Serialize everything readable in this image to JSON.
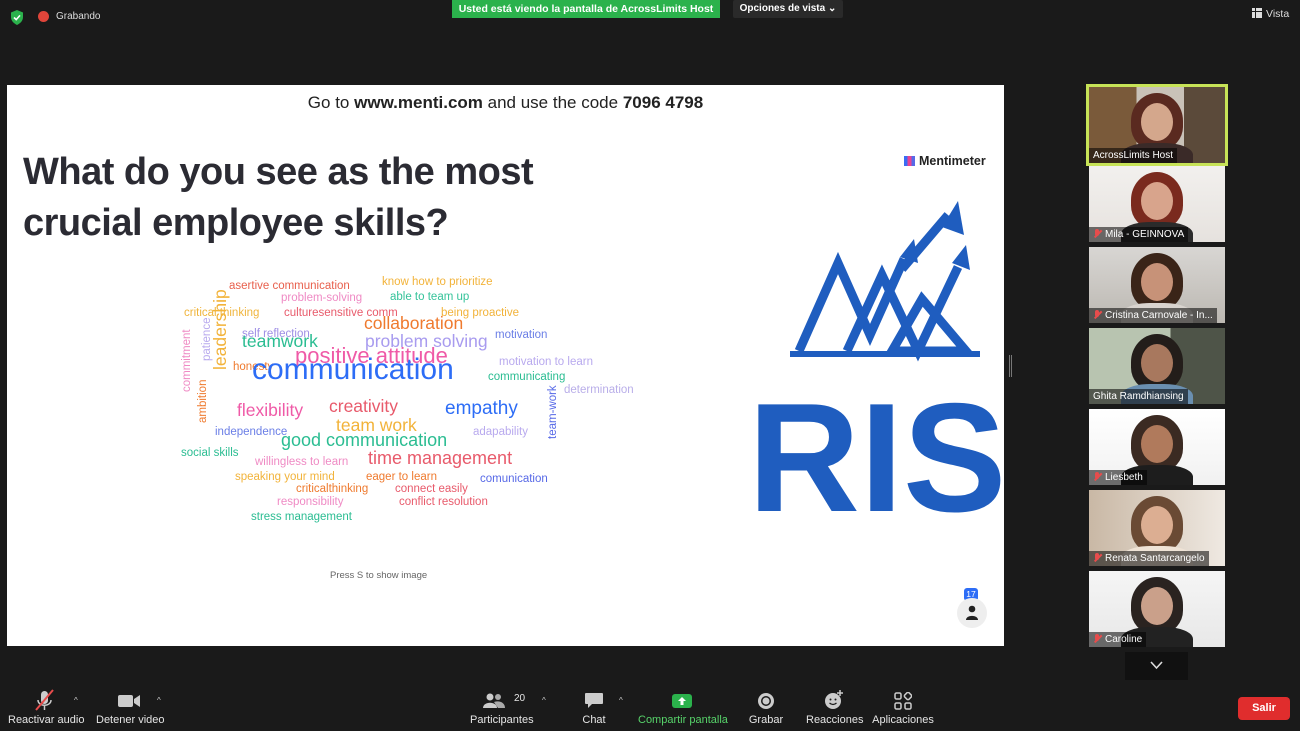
{
  "topbar": {
    "recording_label": "Grabando",
    "viewing_banner": "Usted está viendo la pantalla de AcrossLimits Host",
    "view_options": "Opciones de vista",
    "view_label": "Vista"
  },
  "slide": {
    "join_prefix": "Go to",
    "join_url": "www.menti.com",
    "join_mid": "and use the code",
    "join_code": "7096 4798",
    "question_line1": "What do you see as the most",
    "question_line2": "crucial employee skills?",
    "brand": "Mentimeter",
    "press_hint": "Press S to show image",
    "participant_count": "17",
    "logo_text": "RISE",
    "word_cloud": [
      {
        "text": "asertive communication",
        "color": "#e8604d"
      },
      {
        "text": "know how to prioritize",
        "color": "#f2b33a"
      },
      {
        "text": "problem-solving",
        "color": "#ef8ac4"
      },
      {
        "text": "able to team up",
        "color": "#35c39a"
      },
      {
        "text": "critical thinking",
        "color": "#f0b53d"
      },
      {
        "text": "culturesensitive comm",
        "color": "#e85a6b"
      },
      {
        "text": "being proactive",
        "color": "#f2b33a"
      },
      {
        "text": "collaboration",
        "color": "#ef7a2e"
      },
      {
        "text": "self reflection",
        "color": "#9e8ee5"
      },
      {
        "text": "motivation",
        "color": "#6a7ee6"
      },
      {
        "text": "teamwork",
        "color": "#2bbd92"
      },
      {
        "text": "problem solving",
        "color": "#a89bef"
      },
      {
        "text": "positive attitude",
        "color": "#ef5aa7"
      },
      {
        "text": "motivation to learn",
        "color": "#b8a9ee"
      },
      {
        "text": "honesty",
        "color": "#ef7a2e"
      },
      {
        "text": "communicating",
        "color": "#2bbd92"
      },
      {
        "text": "communication",
        "color": "#2d6df6"
      },
      {
        "text": "determination",
        "color": "#b9aee9"
      },
      {
        "text": "leadership",
        "color": "#f2b33a"
      },
      {
        "text": "patience",
        "color": "#b8a9ee"
      },
      {
        "text": "commitment",
        "color": "#ef8ac4"
      },
      {
        "text": "ambition",
        "color": "#ef7a2e"
      },
      {
        "text": "creativity",
        "color": "#e85a6b"
      },
      {
        "text": "flexibility",
        "color": "#ef5aa7"
      },
      {
        "text": "empathy",
        "color": "#2d6df6"
      },
      {
        "text": "independence",
        "color": "#6a7ee6"
      },
      {
        "text": "team work",
        "color": "#f2b33a"
      },
      {
        "text": "adapability",
        "color": "#b8a9ee"
      },
      {
        "text": "team-work",
        "color": "#5769e7"
      },
      {
        "text": "good communication",
        "color": "#2bbd92"
      },
      {
        "text": "social skills",
        "color": "#2bbd92"
      },
      {
        "text": "willingless to learn",
        "color": "#ef8ac4"
      },
      {
        "text": "time management",
        "color": "#e85a6b"
      },
      {
        "text": "speaking your mind",
        "color": "#f2b33a"
      },
      {
        "text": "eager to learn",
        "color": "#ef7a2e"
      },
      {
        "text": "comunication",
        "color": "#5769e7"
      },
      {
        "text": "criticalthinking",
        "color": "#ef7a2e"
      },
      {
        "text": "connect easily",
        "color": "#e85a6b"
      },
      {
        "text": "responsibility",
        "color": "#ef8ac4"
      },
      {
        "text": "conflict resolution",
        "color": "#e85a6b"
      },
      {
        "text": "stress management",
        "color": "#2bbd92"
      }
    ]
  },
  "participants": [
    {
      "name": "AcrossLimits Host",
      "muted": false
    },
    {
      "name": "Mila - GEINNOVA",
      "muted": true
    },
    {
      "name": "Cristina Carnovale - In...",
      "muted": true
    },
    {
      "name": "Ghita Ramdhiansing",
      "muted": false
    },
    {
      "name": "Liesbeth",
      "muted": true
    },
    {
      "name": "Renata Santarcangelo",
      "muted": true
    },
    {
      "name": "Caroline",
      "muted": true
    }
  ],
  "toolbar": {
    "unmute": "Reactivar audio",
    "stop_video": "Detener video",
    "participants": "Participantes",
    "participants_count": "20",
    "chat": "Chat",
    "share": "Compartir pantalla",
    "record": "Grabar",
    "reactions": "Reacciones",
    "apps": "Aplicaciones",
    "leave": "Salir"
  },
  "colors": {
    "accent_green": "#2bb24c",
    "leave_red": "#e02d2d",
    "rise_blue": "#1f5dbf",
    "active_speaker": "#c7e357"
  }
}
